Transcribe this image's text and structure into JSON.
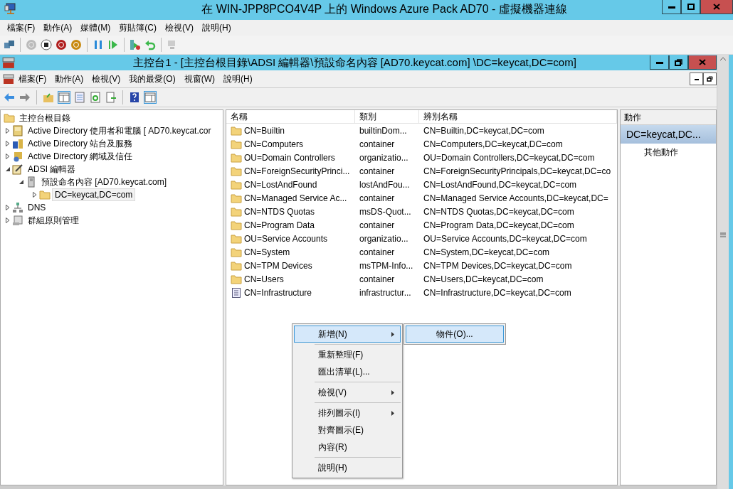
{
  "window": {
    "title": "在 WIN-JPP8PCO4V4P 上的 Windows Azure Pack AD70 - 虛擬機器連線"
  },
  "vm_menu": [
    "檔案(F)",
    "動作(A)",
    "媒體(M)",
    "剪貼簿(C)",
    "檢視(V)",
    "說明(H)"
  ],
  "console": {
    "title": "主控台1 - [主控台根目錄\\ADSI 編輯器\\預設命名內容 [AD70.keycat.com] \\DC=keycat,DC=com]",
    "menu": [
      "檔案(F)",
      "動作(A)",
      "檢視(V)",
      "我的最愛(O)",
      "視窗(W)",
      "說明(H)"
    ]
  },
  "tree": {
    "label": "主控台根目錄",
    "kind": "folder",
    "children": [
      {
        "label": "Active Directory 使用者和電腦 [ AD70.keycat.cor",
        "kind": "book",
        "expanded": false,
        "selected": false
      },
      {
        "label": "Active Directory 站台及服務",
        "kind": "sites",
        "expanded": false,
        "selected": false
      },
      {
        "label": "Active Directory 網域及信任",
        "kind": "domains",
        "expanded": false,
        "selected": false
      },
      {
        "label": "ADSI 編輯器",
        "kind": "editor",
        "expanded": true,
        "selected": false,
        "children": [
          {
            "label": "預設命名內容 [AD70.keycat.com]",
            "kind": "server",
            "expanded": true,
            "selected": false,
            "children": [
              {
                "label": "DC=keycat,DC=com",
                "kind": "folder",
                "expanded": false,
                "selected": true
              }
            ]
          }
        ]
      },
      {
        "label": "DNS",
        "kind": "dns",
        "expanded": false,
        "selected": false
      },
      {
        "label": "群組原則管理",
        "kind": "policy",
        "expanded": false,
        "selected": false
      }
    ]
  },
  "list": {
    "columns": [
      "名稱",
      "類別",
      "辨別名稱"
    ],
    "rows": [
      {
        "kind": "folder",
        "name": "CN=Builtin",
        "type": "builtinDom...",
        "dn": "CN=Builtin,DC=keycat,DC=com"
      },
      {
        "kind": "folder",
        "name": "CN=Computers",
        "type": "container",
        "dn": "CN=Computers,DC=keycat,DC=com"
      },
      {
        "kind": "folder",
        "name": "OU=Domain Controllers",
        "type": "organizatio...",
        "dn": "OU=Domain Controllers,DC=keycat,DC=com"
      },
      {
        "kind": "folder",
        "name": "CN=ForeignSecurityPrinci...",
        "type": "container",
        "dn": "CN=ForeignSecurityPrincipals,DC=keycat,DC=co"
      },
      {
        "kind": "folder",
        "name": "CN=LostAndFound",
        "type": "lostAndFou...",
        "dn": "CN=LostAndFound,DC=keycat,DC=com"
      },
      {
        "kind": "folder",
        "name": "CN=Managed Service Ac...",
        "type": "container",
        "dn": "CN=Managed Service Accounts,DC=keycat,DC="
      },
      {
        "kind": "folder",
        "name": "CN=NTDS Quotas",
        "type": "msDS-Quot...",
        "dn": "CN=NTDS Quotas,DC=keycat,DC=com"
      },
      {
        "kind": "folder",
        "name": "CN=Program Data",
        "type": "container",
        "dn": "CN=Program Data,DC=keycat,DC=com"
      },
      {
        "kind": "folder",
        "name": "OU=Service Accounts",
        "type": "organizatio...",
        "dn": "OU=Service Accounts,DC=keycat,DC=com"
      },
      {
        "kind": "folder",
        "name": "CN=System",
        "type": "container",
        "dn": "CN=System,DC=keycat,DC=com"
      },
      {
        "kind": "folder",
        "name": "CN=TPM Devices",
        "type": "msTPM-Info...",
        "dn": "CN=TPM Devices,DC=keycat,DC=com"
      },
      {
        "kind": "folder",
        "name": "CN=Users",
        "type": "container",
        "dn": "CN=Users,DC=keycat,DC=com"
      },
      {
        "kind": "document",
        "name": "CN=Infrastructure",
        "type": "infrastructur...",
        "dn": "CN=Infrastructure,DC=keycat,DC=com"
      }
    ]
  },
  "actions": {
    "header": "動作",
    "section": "DC=keycat,DC...",
    "items": [
      "其他動作"
    ]
  },
  "context_menu": [
    {
      "kind": "item",
      "label": "新增(N)",
      "submenu": true,
      "selected": true
    },
    {
      "kind": "separator"
    },
    {
      "kind": "item",
      "label": "重新整理(F)",
      "submenu": false,
      "selected": false
    },
    {
      "kind": "item",
      "label": "匯出清單(L)...",
      "submenu": false,
      "selected": false
    },
    {
      "kind": "separator"
    },
    {
      "kind": "item",
      "label": "檢視(V)",
      "submenu": true,
      "selected": false
    },
    {
      "kind": "separator"
    },
    {
      "kind": "item",
      "label": "排列圖示(I)",
      "submenu": true,
      "selected": false
    },
    {
      "kind": "item",
      "label": "對齊圖示(E)",
      "submenu": false,
      "selected": false
    },
    {
      "kind": "item",
      "label": "內容(R)",
      "submenu": false,
      "selected": false
    },
    {
      "kind": "separator"
    },
    {
      "kind": "item",
      "label": "說明(H)",
      "submenu": false,
      "selected": false
    }
  ],
  "submenu": [
    {
      "label": "物件(O)...",
      "selected": true
    }
  ]
}
